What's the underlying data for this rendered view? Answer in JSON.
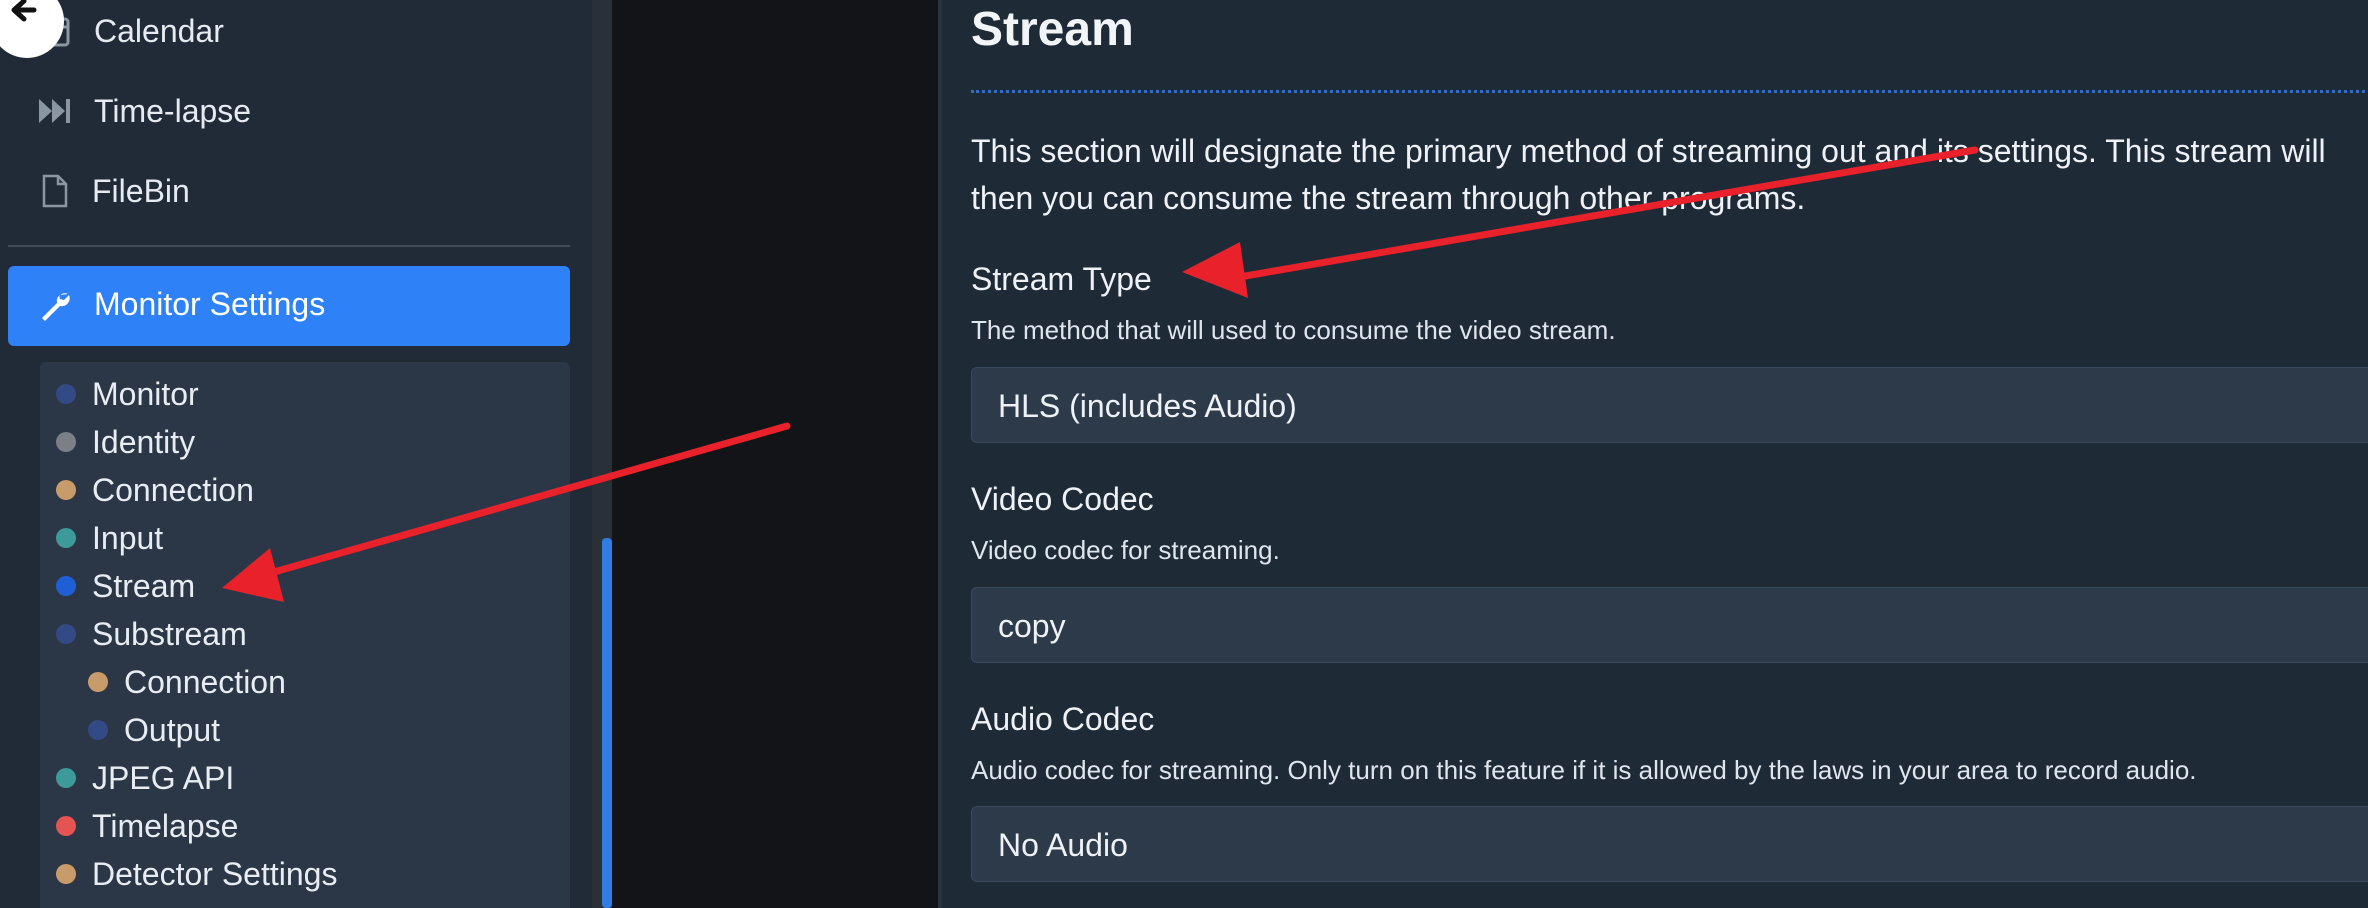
{
  "sidebar": {
    "nav_items": [
      {
        "label": "Calendar",
        "icon": "calendar-icon"
      },
      {
        "label": "Time-lapse",
        "icon": "fast-forward-icon"
      },
      {
        "label": "FileBin",
        "icon": "file-icon"
      }
    ],
    "active": {
      "label": "Monitor Settings",
      "icon": "wrench-icon"
    },
    "sections": [
      {
        "label": "Monitor",
        "color": "#344a86"
      },
      {
        "label": "Identity",
        "color": "#7b7f86"
      },
      {
        "label": "Connection",
        "color": "#c89b6b"
      },
      {
        "label": "Input",
        "color": "#3c9a9a"
      },
      {
        "label": "Stream",
        "color": "#1f5fd6"
      },
      {
        "label": "Substream",
        "color": "#344a86"
      },
      {
        "label": "Connection",
        "color": "#c89b6b"
      },
      {
        "label": "Output",
        "color": "#344a86"
      },
      {
        "label": "JPEG API",
        "color": "#3c9a9a"
      },
      {
        "label": "Timelapse",
        "color": "#e55353"
      },
      {
        "label": "Detector Settings",
        "color": "#c89b6b"
      }
    ]
  },
  "main": {
    "title": "Stream",
    "intro_line1": "This section will designate the primary method of streaming out and its settings. This stream will",
    "intro_line2": "then you can consume the stream through other programs.",
    "fields": [
      {
        "label": "Stream Type",
        "help": "The method that will used to consume the video stream.",
        "value": "HLS (includes Audio)"
      },
      {
        "label": "Video Codec",
        "help": "Video codec for streaming.",
        "value": "copy"
      },
      {
        "label": "Audio Codec",
        "help": "Audio codec for streaming. Only turn on this feature if it is allowed by the laws in your area to record audio.",
        "value": "No Audio"
      }
    ]
  },
  "colors": {
    "accent": "#2f81f7",
    "annotation_arrow": "#e8212b"
  }
}
